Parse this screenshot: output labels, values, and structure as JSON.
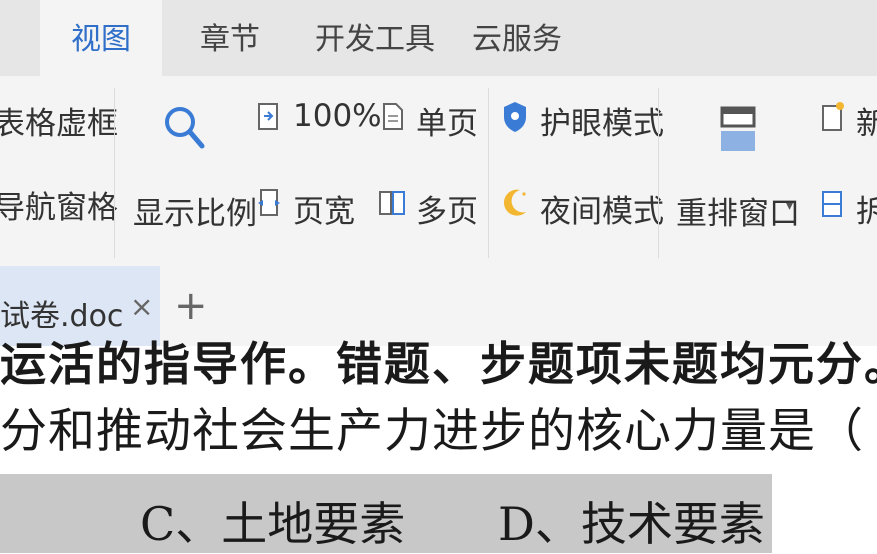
{
  "tabs": [
    {
      "label": "视图",
      "active": true
    },
    {
      "label": "章节",
      "active": false
    },
    {
      "label": "开发工具",
      "active": false
    },
    {
      "label": "云服务",
      "active": false
    }
  ],
  "ribbon": {
    "table_grid_label": "表格虚框",
    "nav_pane_label": "导航窗格",
    "zoom_label": "显示比例",
    "hundred_percent_label": "100%",
    "single_page_label": "单页",
    "page_width_label": "页宽",
    "multi_page_label": "多页",
    "eye_care_label": "护眼模式",
    "night_mode_label": "夜间模式",
    "rearrange_label": "重排窗口",
    "new_label": "新",
    "split_label": "拆"
  },
  "document_tab": {
    "title": "试卷.doc",
    "close_glyph": "×",
    "new_tab_glyph": "+"
  },
  "document": {
    "line1": "运活的指导作。错题、步题项未题均元分。",
    "line2": "分和推动社会生产力进步的核心力量是（",
    "option_b_fragment": "、",
    "option_c": "C、土地要素",
    "option_d": "D、技术要素"
  },
  "colors": {
    "accent": "#2f6fc9",
    "ribbon_bg": "#f4f4f4",
    "tabbar_bg": "#e6e6e6",
    "doctab_bg": "#dde6f4",
    "option_highlight": "#c8c8c8"
  }
}
